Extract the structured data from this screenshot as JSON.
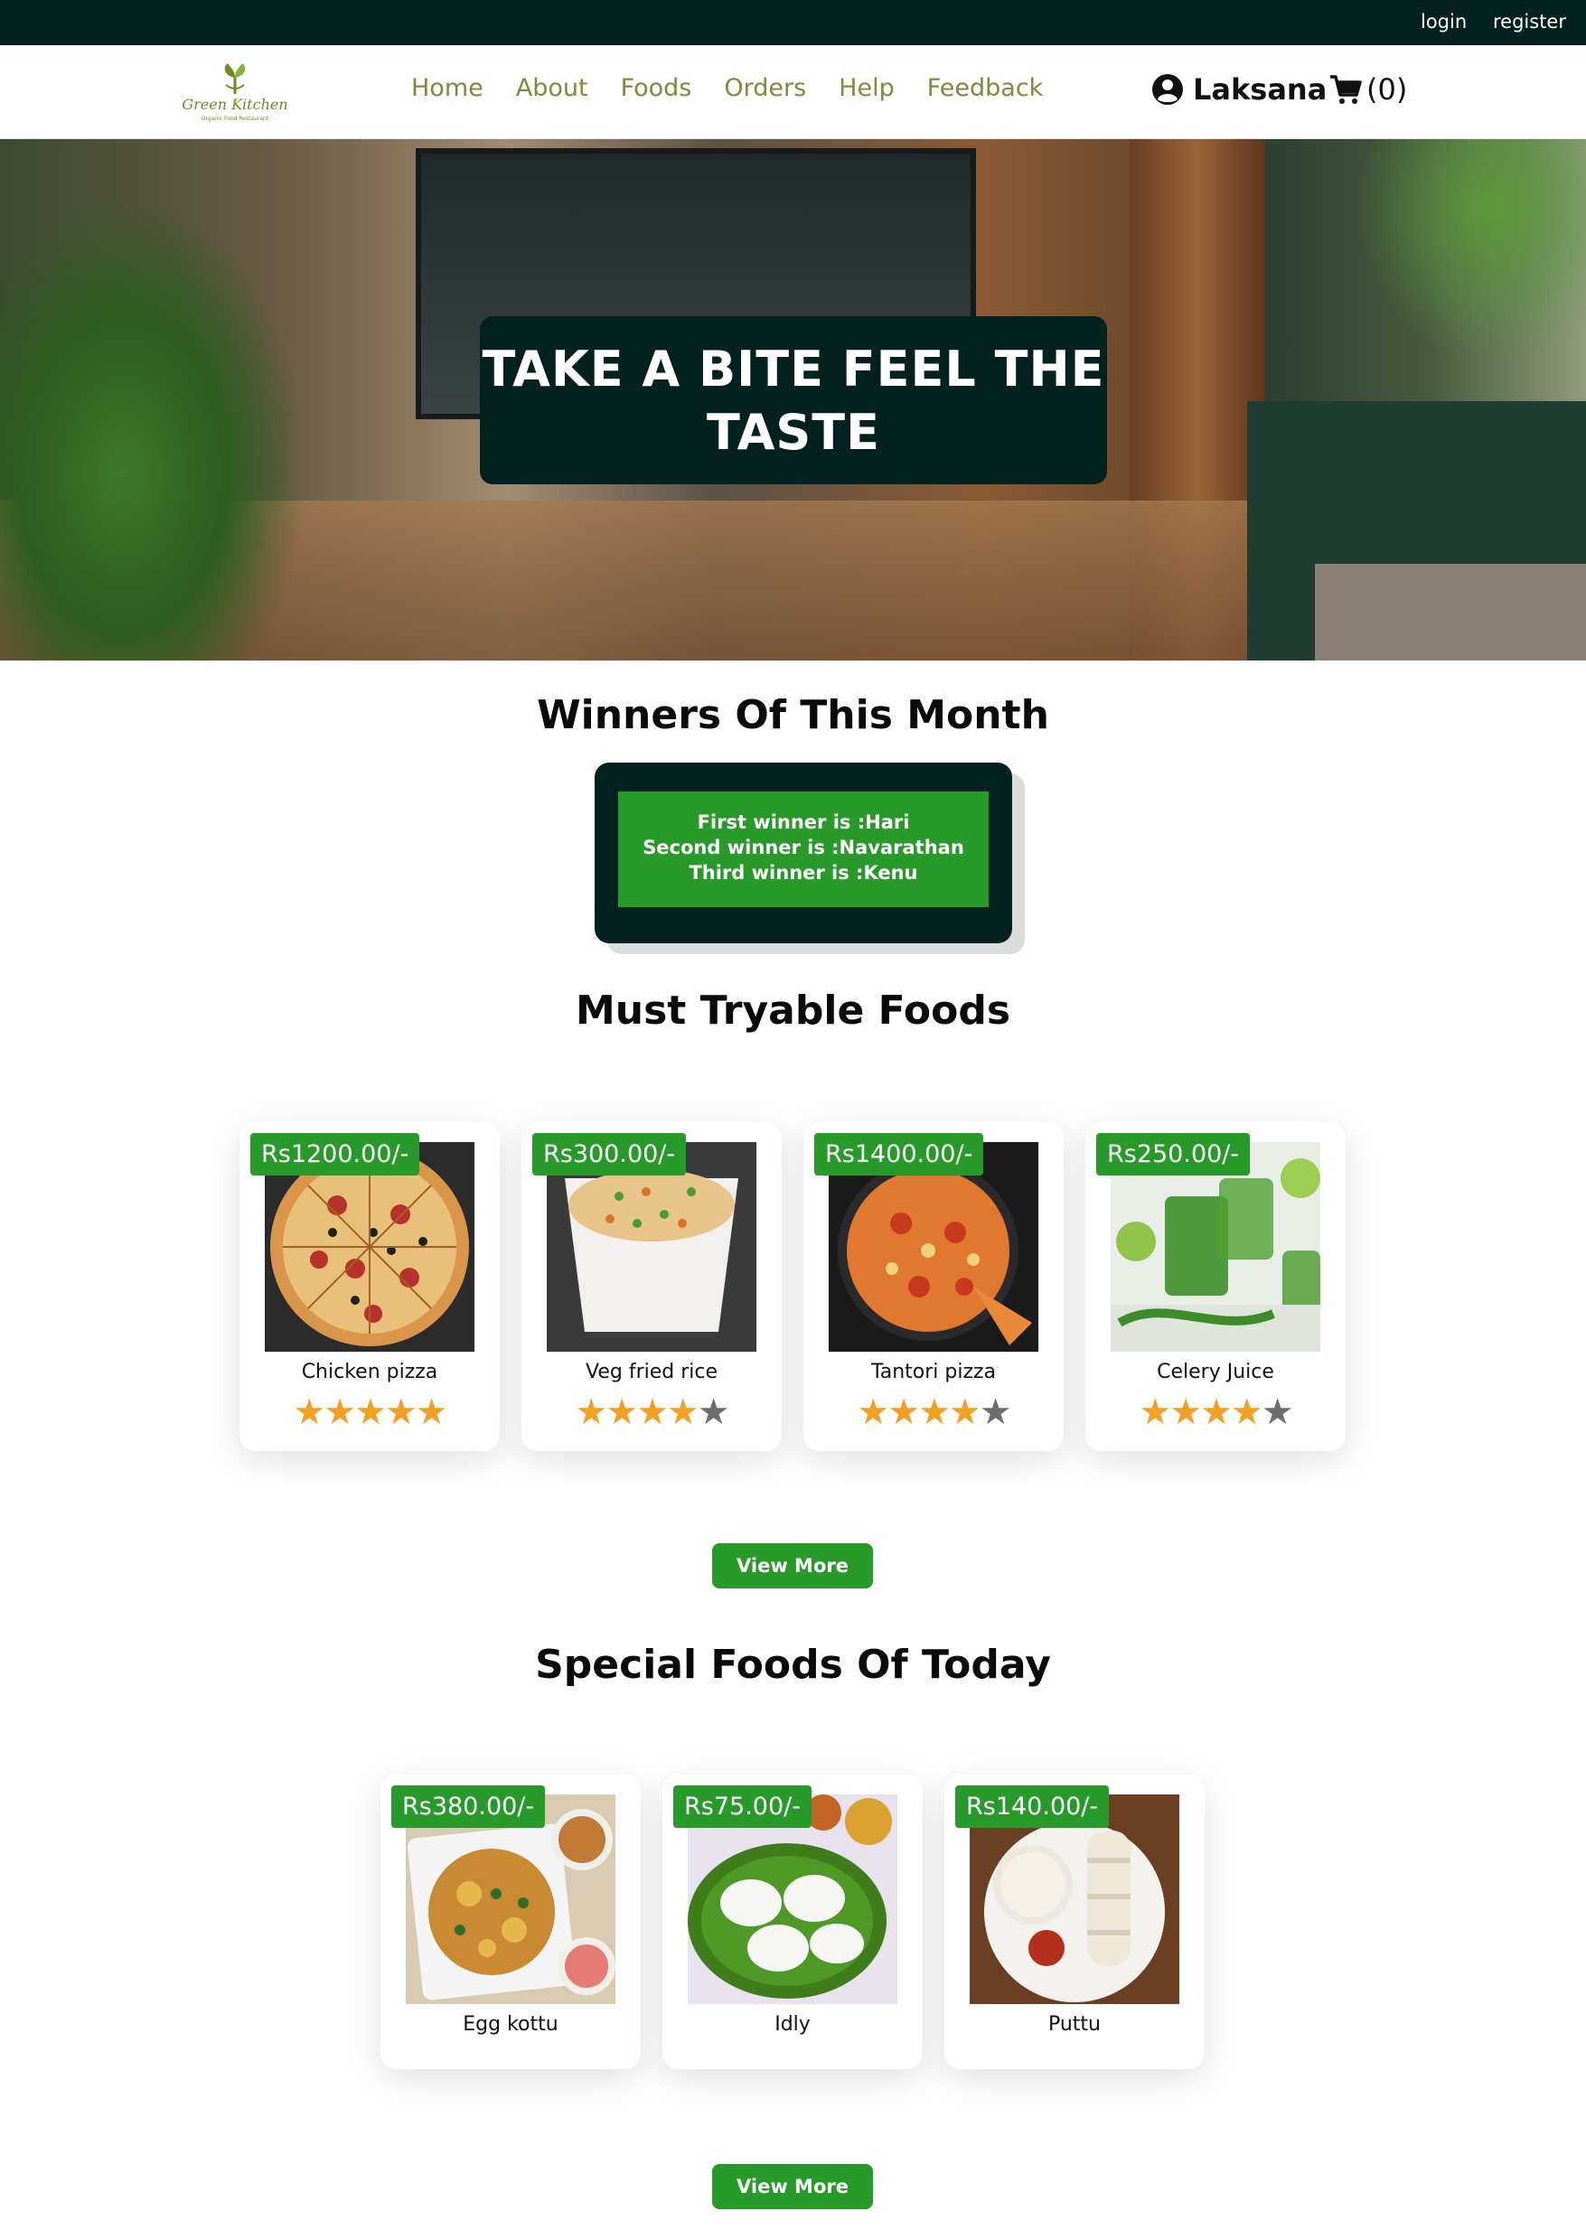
{
  "topbar": {
    "login": "login",
    "register": "register"
  },
  "nav": {
    "brand": "Green Kitchen",
    "tagline": "Organic Food Restaurant",
    "links": [
      "Home",
      "About",
      "Foods",
      "Orders",
      "Help",
      "Feedback"
    ],
    "user_name": "Laksana",
    "cart_count": "(0)"
  },
  "hero": {
    "line1": "TAKE A BITE FEEL THE",
    "line2": "TASTE"
  },
  "winners": {
    "heading": "Winners Of This Month",
    "first": "First winner is :Hari",
    "second": "Second winner is :Navarathan",
    "third": "Third winner is :Kenu"
  },
  "must_try": {
    "heading": "Must Tryable Foods",
    "items": [
      {
        "price": "Rs1200.00/-",
        "name": "Chicken pizza",
        "rating": 5,
        "image": "pizza"
      },
      {
        "price": "Rs300.00/-",
        "name": "Veg fried rice",
        "rating": 4.5,
        "image": "fried-rice"
      },
      {
        "price": "Rs1400.00/-",
        "name": "Tantori pizza",
        "rating": 4.5,
        "image": "tandoori-pizza"
      },
      {
        "price": "Rs250.00/-",
        "name": "Celery Juice",
        "rating": 4.5,
        "image": "celery-juice"
      }
    ],
    "view_more": "View More"
  },
  "special": {
    "heading": "Special Foods Of Today",
    "items": [
      {
        "price": "Rs380.00/-",
        "name": "Egg kottu",
        "image": "egg-kottu"
      },
      {
        "price": "Rs75.00/-",
        "name": "Idly",
        "image": "idly"
      },
      {
        "price": "Rs140.00/-",
        "name": "Puttu",
        "image": "puttu"
      }
    ],
    "view_more": "View More"
  },
  "colors": {
    "dark": "#03211e",
    "accent": "#289a2a",
    "nav_link": "#7b8c3b",
    "star": "#f2a024"
  }
}
